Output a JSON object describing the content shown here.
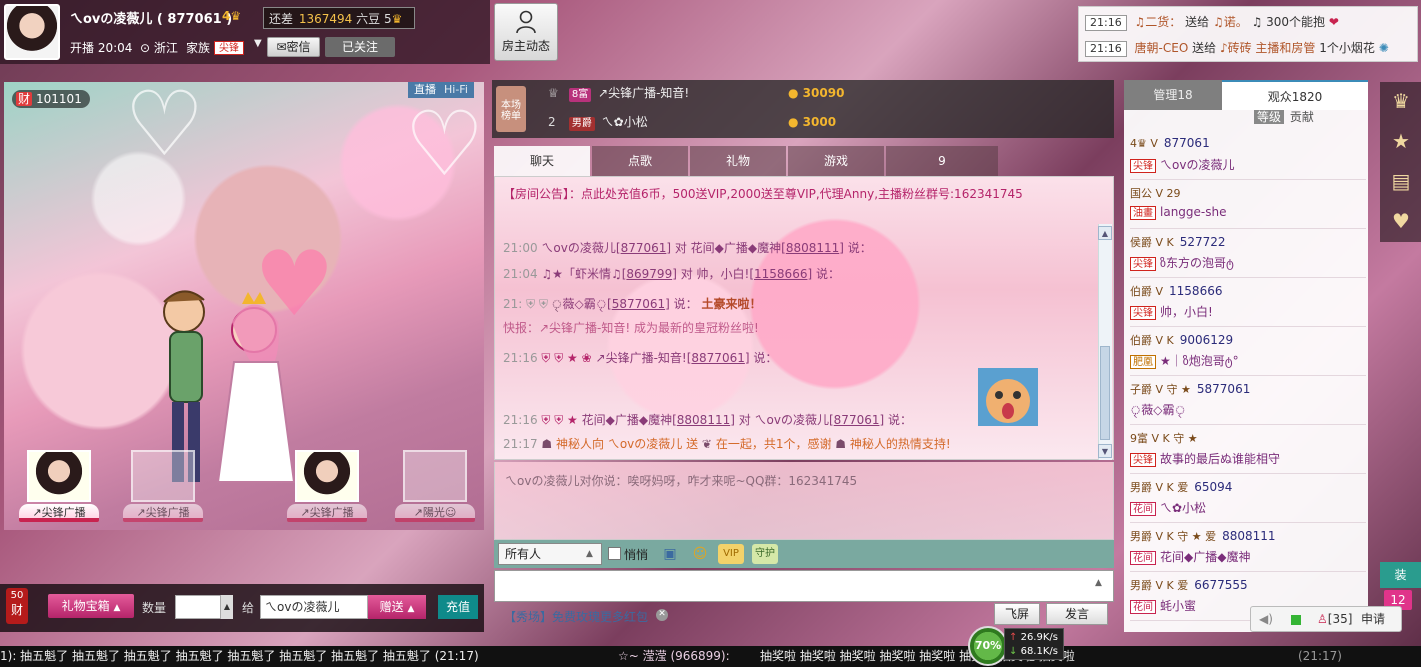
{
  "header": {
    "anchor_name": "ㄟovの凌薇儿 ( 877061 )",
    "crown_level": "4",
    "start_label": "开播 20:04",
    "location": "浙江",
    "family_label": "家族",
    "family_tag": "尖锋",
    "pm_label": "密信",
    "follow_label": "已关注",
    "gap_label": "还差",
    "gap_value": "1367494",
    "gap_target": "六豆 5",
    "host_feed_label": "房主动态"
  },
  "notifications": [
    {
      "time": "21:16",
      "user": "♫二货：",
      "verb": "送给",
      "gift": "♫诺。",
      "count": "♫ 300个能抱"
    },
    {
      "time": "21:16",
      "user": "唐朝-CEO",
      "verb": "送给",
      "gift": "♪砖砖 主播和房管",
      "count": "1个小烟花"
    }
  ],
  "video": {
    "wealth_value": "101101",
    "wealth_tag": "财",
    "live_label": "直播",
    "quality_label": "Hi-Fi",
    "slots": [
      {
        "label": "↗尖锋广播"
      },
      {
        "label": "↗尖锋广播"
      },
      {
        "label": "↗尖锋广播"
      },
      {
        "label": "↗陽光☺"
      }
    ]
  },
  "gift_bar": {
    "wealth_level": "50",
    "wealth_char": "财",
    "giftbox_label": "礼物宝箱",
    "qty_label": "数量",
    "to_label": "给",
    "recipient": "ㄟovの凌薇儿",
    "send_label": "赠送",
    "recharge_label": "充值"
  },
  "rank": {
    "stage_label": "本场 榜单",
    "rows": [
      {
        "num": "1",
        "title": "8富",
        "name": "↗尖锋广播-知音!",
        "score": "30090"
      },
      {
        "num": "2",
        "title": "男爵",
        "name": "ㄟ✿小松",
        "score": "3000"
      }
    ]
  },
  "chat_tabs": [
    "聊天",
    "点歌",
    "礼物",
    "游戏",
    "9"
  ],
  "chat": {
    "notice": "【房间公告】：点此处充值6币，500送VIP,2000送至尊VIP,代理Anny,主播粉丝群号:162341745",
    "lines": [
      {
        "time": "21:00",
        "text": "ㄟovの凌薇儿[",
        "id": "877061",
        "rest": "] 对 花间◆广播◆魔神[",
        "id2": "8808111",
        "tail": "] 说："
      },
      {
        "time": "21:04",
        "text": "♫★「虾米情♫[",
        "id": "869799",
        "rest": "] 对 帅，小白![",
        "id2": "1158666",
        "tail": "] 说："
      },
      {
        "time": "21:",
        "text": "ৃ薇◇霸ৃ[",
        "id": "5877061",
        "rest": "] 说：",
        "id2": "",
        "tail": "土豪来啦！"
      },
      {
        "time": "",
        "text": "快报：↗尖锋广播-知音!",
        "id": "",
        "rest": "成为最新的皇冠粉丝啦!",
        "id2": "",
        "tail": ""
      },
      {
        "time": "21:16",
        "text": "↗尖锋广播-知音![",
        "id": "8877061",
        "rest": "] 说：",
        "id2": "",
        "tail": ""
      },
      {
        "time": "21:16",
        "text": "花间◆广播◆魔神[",
        "id": "8808111",
        "rest": "] 对 ㄟovの凌薇儿[",
        "id2": "877061",
        "tail": "] 说："
      },
      {
        "time": "21:17",
        "text": "神秘人向 ㄟovの凌薇儿 送",
        "id": "",
        "rest": "在一起，共1个，感谢",
        "id2": "",
        "tail": "神秘人的热情支持!"
      }
    ],
    "private": "ㄟovの凌薇儿对你说：唉呀妈呀，咋才来呢~QQ群：162341745"
  },
  "chat_toolbar": {
    "recipient": "所有人",
    "whisper_label": "悄悄",
    "vip_label": "VIP",
    "guard_label": "守护"
  },
  "bottom_links": {
    "promo": "【秀场】免费玫瑰更多红包",
    "fullscreen": "飞屏",
    "post": "发言"
  },
  "audience": {
    "admin_tab": "管理18",
    "viewers_tab": "观众1820",
    "sort_grade": "等级",
    "sort_contrib": "贡献",
    "members": [
      {
        "badges": "4♛ V",
        "id": "877061",
        "tag": "尖锋",
        "nick": "ㄟovの凌薇儿"
      },
      {
        "badges": "国公 V 29",
        "id": "",
        "tag": "油畫",
        "nick": "langge-she"
      },
      {
        "badges": "侯爵 V K",
        "id": "527722",
        "tag": "尖锋",
        "nick": "ზ东方の泡哥ტ"
      },
      {
        "badges": "伯爵 V",
        "id": "1158666",
        "tag": "尖锋",
        "nick": "帅，小白!"
      },
      {
        "badges": "伯爵 V K",
        "id": "9006129",
        "tag": "肥凰",
        "nick": "★｜ზ炮泡哥ტ°"
      },
      {
        "badges": "子爵 V 守 ★",
        "id": "5877061",
        "tag": "",
        "nick": "ৃ薇◇霸ৃ"
      },
      {
        "badges": "9富 V K 守 ★",
        "id": "",
        "tag": "尖锋",
        "nick": "故事的最后ぬ谁能相守"
      },
      {
        "badges": "男爵 V K 爱",
        "id": "65094",
        "tag": "花间",
        "nick": "ㄟ✿小松"
      },
      {
        "badges": "男爵 V K 守 ★ 爱",
        "id": "8808111",
        "tag": "花间",
        "nick": "花间◆广播◆魔神"
      },
      {
        "badges": "男爵 V K 爱",
        "id": "6677555",
        "tag": "花间",
        "nick": "蚝小蜜"
      }
    ]
  },
  "ticker": {
    "left": "1):  抽五魁了 抽五魁了 抽五魁了 抽五魁了 抽五魁了 抽五魁了 抽五魁了 抽五魁了 (21:17)",
    "mid": "☆~ 滢滢 (966899):",
    "right": "抽奖啦   抽奖啦   抽奖啦   抽奖啦   抽奖啦   抽奖啦   抽奖啦   抽奖啦",
    "time": "(21:17)"
  },
  "network": {
    "cpu": "70%",
    "up": "26.9K/s",
    "down": "68.1K/s"
  },
  "utility": {
    "mic_count": "[35]",
    "apply": "申请",
    "unread": "12",
    "side_tab": "装"
  },
  "colors": {
    "accent_pink": "#c8234f",
    "teal": "#0f8a8a",
    "gold": "#f3b62e"
  }
}
